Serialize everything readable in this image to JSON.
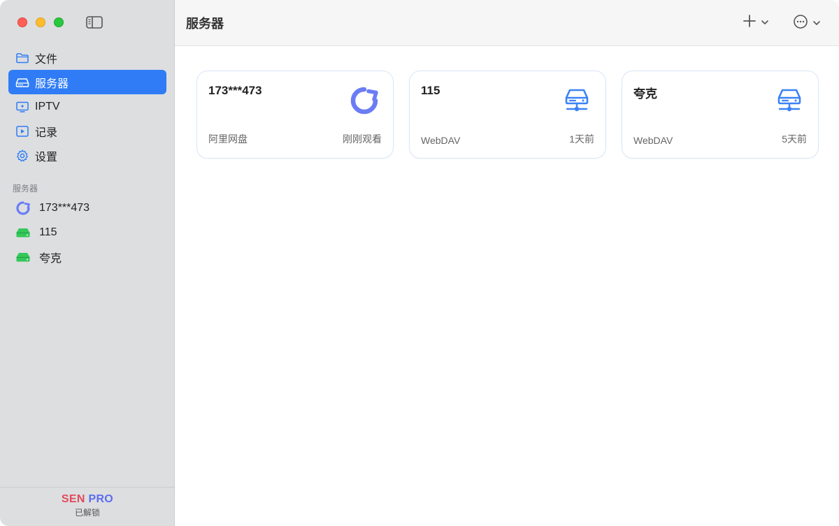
{
  "colors": {
    "accent": "#2f7cf6",
    "sidebar_bg": "#dcdee0",
    "aliyun_icon": "#6b7cf5",
    "server_green": "#34c759",
    "webdav_icon": "#3b82f6"
  },
  "sidebar": {
    "nav": [
      {
        "label": "文件",
        "icon": "folder-icon"
      },
      {
        "label": "服务器",
        "icon": "server-drive-icon",
        "active": true
      },
      {
        "label": "IPTV",
        "icon": "tv-icon"
      },
      {
        "label": "记录",
        "icon": "play-square-icon"
      },
      {
        "label": "设置",
        "icon": "gear-icon"
      }
    ],
    "section_title": "服务器",
    "servers": [
      {
        "label": "173***473",
        "icon": "aliyun-drive-icon"
      },
      {
        "label": "115",
        "icon": "green-drive-icon"
      },
      {
        "label": "夸克",
        "icon": "green-drive-icon"
      }
    ],
    "footer": {
      "brand_sen": "SEN",
      "brand_pro": "PRO",
      "status": "已解锁"
    }
  },
  "header": {
    "title": "服务器"
  },
  "cards": [
    {
      "name": "173***473",
      "type": "阿里网盘",
      "time": "刚刚观看",
      "icon": "aliyun-drive-icon"
    },
    {
      "name": "115",
      "type": "WebDAV",
      "time": "1天前",
      "icon": "webdav-server-icon"
    },
    {
      "name": "夸克",
      "type": "WebDAV",
      "time": "5天前",
      "icon": "webdav-server-icon"
    }
  ]
}
